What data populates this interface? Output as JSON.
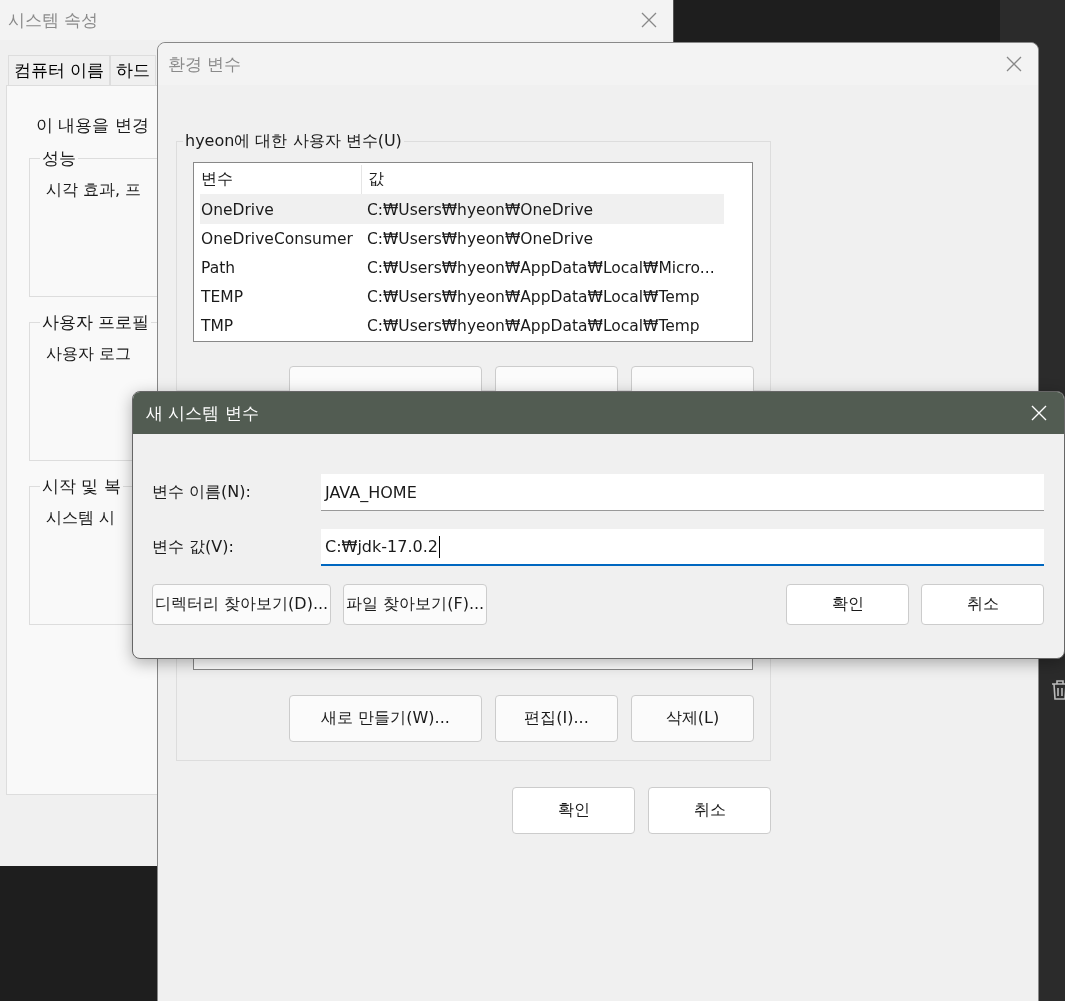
{
  "system_properties": {
    "title": "시스템 속성",
    "tabs": [
      "컴퓨터 이름",
      "하드"
    ],
    "intro": "이 내용을 변경",
    "groups": [
      {
        "title": "성능",
        "text": "시각 효과, 프"
      },
      {
        "title": "사용자 프로필",
        "text": "사용자 로그"
      },
      {
        "title": "시작 및 복",
        "text": "시스템 시"
      }
    ]
  },
  "environment_variables": {
    "title": "환경 변수",
    "user_variables": {
      "title": "hyeon에 대한 사용자 변수(U)",
      "columns": [
        "변수",
        "값"
      ],
      "rows": [
        {
          "name": "OneDrive",
          "value": "C:₩Users₩hyeon₩OneDrive",
          "selected": true
        },
        {
          "name": "OneDriveConsumer",
          "value": "C:₩Users₩hyeon₩OneDrive",
          "selected": false
        },
        {
          "name": "Path",
          "value": "C:₩Users₩hyeon₩AppData₩Local₩Micro...",
          "selected": false
        },
        {
          "name": "TEMP",
          "value": "C:₩Users₩hyeon₩AppData₩Local₩Temp",
          "selected": false
        },
        {
          "name": "TMP",
          "value": "C:₩Users₩hyeon₩AppData₩Local₩Temp",
          "selected": false
        }
      ]
    },
    "system_buttons": [
      "새로 만들기(W)...",
      "편집(I)...",
      "삭제(L)"
    ],
    "buttons": [
      "확인",
      "취소"
    ]
  },
  "new_system_variable": {
    "title": "새 시스템 변수",
    "fields": [
      {
        "label": "변수 이름(N):",
        "value": "JAVA_HOME",
        "focused": false
      },
      {
        "label": "변수 값(V):",
        "value": "C:₩jdk-17.0.2",
        "focused": true
      }
    ],
    "browse_buttons": [
      "디렉터리 찾아보기(D)...",
      "파일 찾아보기(F)..."
    ],
    "buttons": [
      "확인",
      "취소"
    ]
  }
}
